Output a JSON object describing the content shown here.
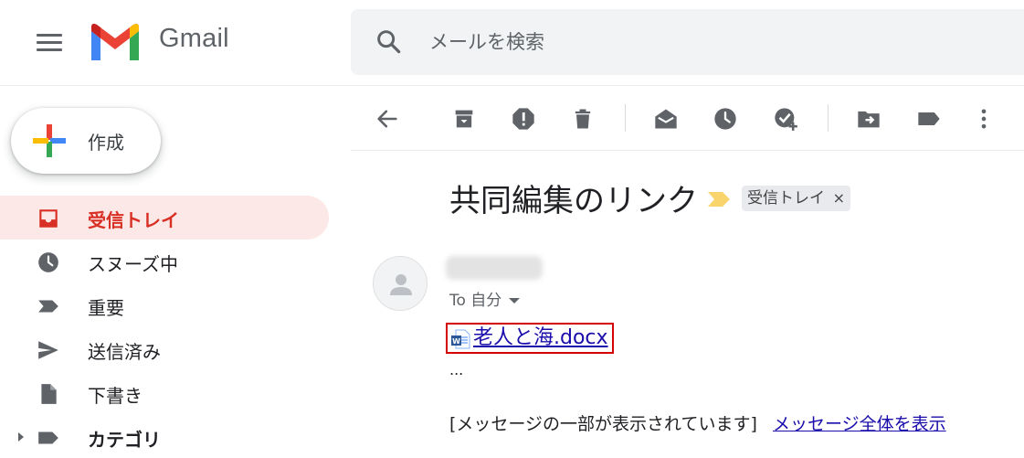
{
  "header": {
    "app_name": "Gmail",
    "search_placeholder": "メールを検索"
  },
  "compose": {
    "label": "作成"
  },
  "sidebar": {
    "items": [
      {
        "label": "受信トレイ",
        "icon": "inbox-icon",
        "active": true
      },
      {
        "label": "スヌーズ中",
        "icon": "clock-icon"
      },
      {
        "label": "重要",
        "icon": "label-important-icon"
      },
      {
        "label": "送信済み",
        "icon": "send-icon"
      },
      {
        "label": "下書き",
        "icon": "draft-icon"
      },
      {
        "label": "カテゴリ",
        "icon": "label-icon",
        "bold": true,
        "expandable": true
      }
    ]
  },
  "toolbar": {
    "buttons": [
      "back-arrow-icon",
      "archive-icon",
      "report-spam-icon",
      "delete-icon",
      "mark-unread-icon",
      "snooze-icon",
      "add-task-icon",
      "move-to-icon",
      "labels-icon",
      "more-vert-icon"
    ]
  },
  "message": {
    "subject": "共同編集のリンク",
    "label_chip": "受信トレイ",
    "label_chip_close": "×",
    "to_line": "To 自分",
    "attachment_name": "老人と海.docx",
    "ellipsis": "...",
    "clipped_note": "[メッセージの一部が表示されています]",
    "view_full": "メッセージ全体を表示"
  },
  "colors": {
    "active_nav_bg": "#fce8e6",
    "active_nav_text": "#d93025",
    "link": "#1a0dab",
    "highlight_border": "#d50000",
    "importance": "#f9d36b"
  }
}
